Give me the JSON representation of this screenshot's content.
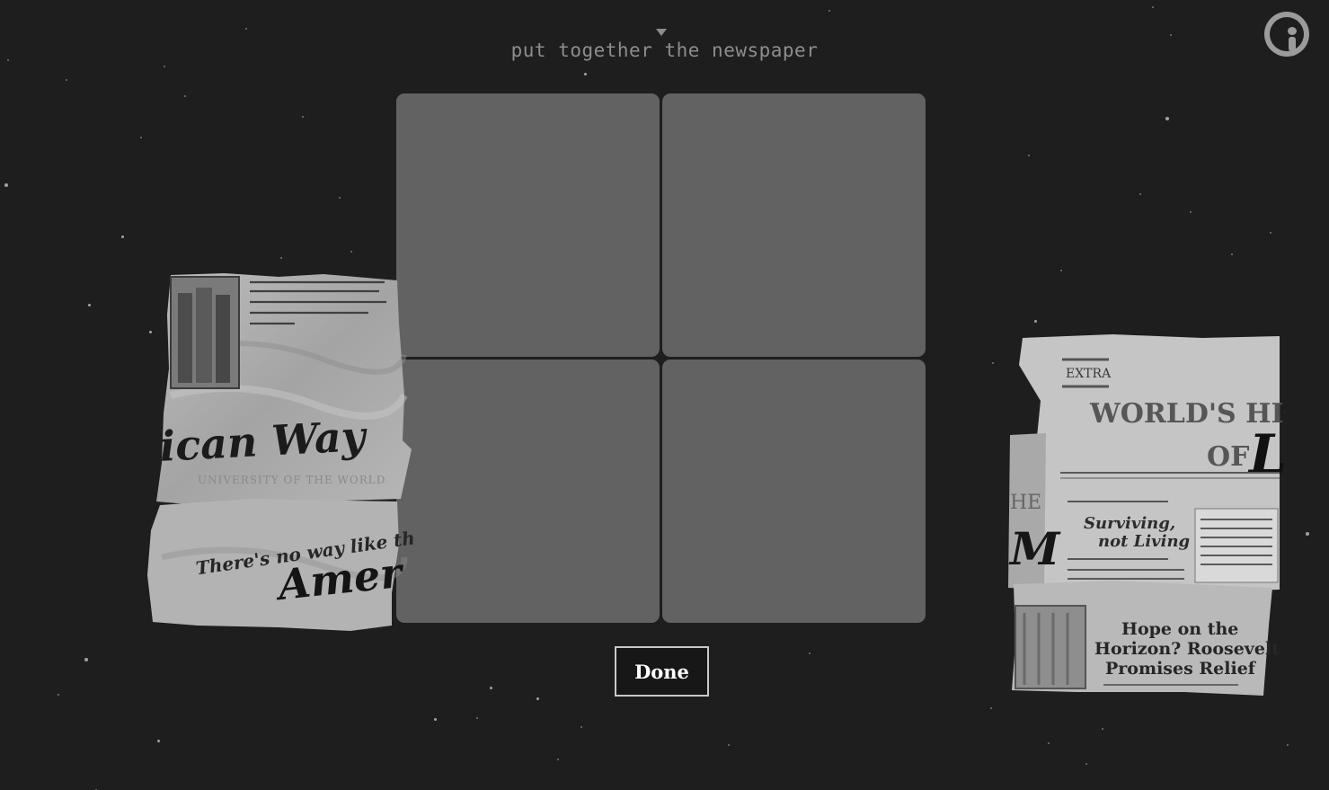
{
  "instruction": "put together the newspaper",
  "done_label": "Done",
  "icons": {
    "info": "info-icon",
    "caret": "caret-down-icon"
  },
  "board": {
    "slot_color": "#626262",
    "slots": [
      {
        "id": "slot-1"
      },
      {
        "id": "slot-2"
      },
      {
        "id": "slot-3"
      },
      {
        "id": "slot-4"
      }
    ]
  },
  "left_piece": {
    "headline_fragment": "ican Way",
    "faded_line": "UNIVERSITY OF THE WORLD",
    "tagline": "There's no way like the",
    "script_fragment": "Amer"
  },
  "right_piece": {
    "badge": "EXTRA",
    "headline_line1": "WORLD'S HIG",
    "headline_line2": "OF",
    "headline_cap": "L",
    "side_fragment_1": "HE",
    "side_fragment_2": "M",
    "sub_line1": "Surviving,",
    "sub_line2": "not Living",
    "story_headline_1": "Hope on the",
    "story_headline_2": "Horizon? Roosevelt",
    "story_headline_3": "Promises Relief"
  },
  "colors": {
    "background": "#1e1e1e",
    "text_muted": "#8d8d8d",
    "button_border": "#c8c8c8"
  }
}
